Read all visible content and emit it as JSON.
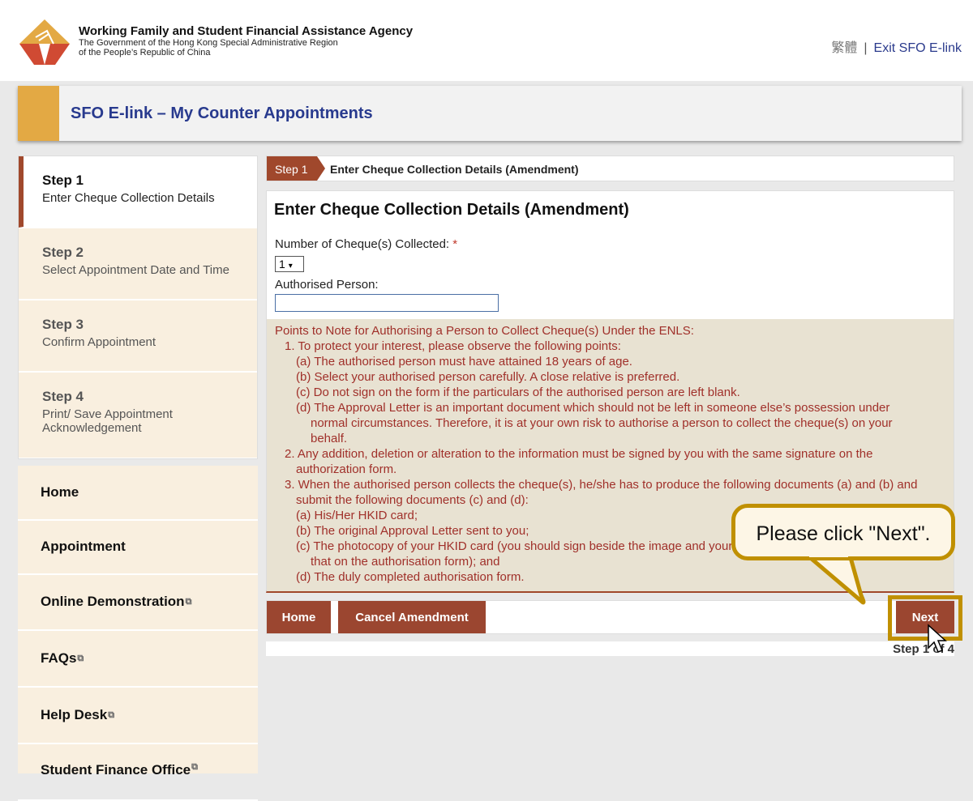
{
  "header": {
    "agency_name": "Working Family and Student Financial Assistance Agency",
    "gov_line1": "The Government of the Hong Kong Special Administrative Region",
    "gov_line2": "of the People’s Republic of China",
    "lang_link": "繁體",
    "separator": "|",
    "exit_link": "Exit SFO E-link"
  },
  "title": "SFO E-link – My Counter Appointments",
  "steps": [
    {
      "label": "Step 1",
      "desc": "Enter Cheque Collection Details",
      "active": true
    },
    {
      "label": "Step 2",
      "desc": "Select Appointment Date and Time"
    },
    {
      "label": "Step 3",
      "desc": "Confirm Appointment"
    },
    {
      "label": "Step 4",
      "desc": "Print/ Save Appointment Acknowledgement"
    }
  ],
  "nav": [
    {
      "label": "Home"
    },
    {
      "label": "Appointment"
    },
    {
      "label": "Online Demonstration",
      "external": true
    },
    {
      "label": "FAQs",
      "external": true
    },
    {
      "label": "Help Desk",
      "external": true
    },
    {
      "label": "Student Finance Office",
      "external": true
    }
  ],
  "breadcrumb": {
    "step": "Step 1",
    "title": "Enter Cheque Collection Details (Amendment)"
  },
  "form": {
    "heading": "Enter Cheque Collection Details (Amendment)",
    "cheques_label": "Number of Cheque(s) Collected:",
    "required_mark": "*",
    "cheques_value": "1",
    "authorised_label": "Authorised Person:",
    "authorised_value": ""
  },
  "notes": [
    {
      "level": 0,
      "text": "Points to Note for Authorising a Person to Collect Cheque(s) Under the ENLS:"
    },
    {
      "level": 1,
      "text": "1. To protect your interest, please observe the following points:"
    },
    {
      "level": 2,
      "text": "(a) The authorised person must have attained 18 years of age."
    },
    {
      "level": 2,
      "text": "(b) Select your authorised person carefully. A close relative is preferred."
    },
    {
      "level": 2,
      "text": "(c) Do not sign on the form if the particulars of the authorised person are left blank."
    },
    {
      "level": 2,
      "text": "(d) The Approval Letter is an important document which should not be left in someone else’s possession under"
    },
    {
      "level": 3,
      "text": "normal circumstances. Therefore, it is at your own risk to authorise a person to collect the cheque(s) on your"
    },
    {
      "level": 3,
      "text": "behalf."
    },
    {
      "level": 1,
      "text": "2. Any addition, deletion or alteration to the information must be signed by you with the same signature on the"
    },
    {
      "level": 2,
      "text": "authorization form."
    },
    {
      "level": 1,
      "text": "3. When the authorised person collects the cheque(s), he/she has to produce the following documents (a) and (b) and"
    },
    {
      "level": 2,
      "text": "submit the following documents (c) and (d):"
    },
    {
      "level": 2,
      "text": "(a) His/Her HKID card;"
    },
    {
      "level": 2,
      "text": "(b) The original Approval Letter sent to you;"
    },
    {
      "level": 2,
      "text": "(c) The photocopy of your HKID card (you should sign beside the image and your signature should be the same as"
    },
    {
      "level": 3,
      "text": "that on the authorisation form); and"
    },
    {
      "level": 2,
      "text": "(d) The duly completed authorisation form."
    }
  ],
  "actions": {
    "home": "Home",
    "cancel": "Cancel Amendment",
    "next": "Next"
  },
  "footer": {
    "progress": "Step 1 of 4"
  },
  "callout": {
    "text": "Please click \"Next\"."
  },
  "colors": {
    "accent": "#a0482c",
    "title": "#283a8e",
    "highlight": "#c09000",
    "panel": "#f9efdf"
  }
}
